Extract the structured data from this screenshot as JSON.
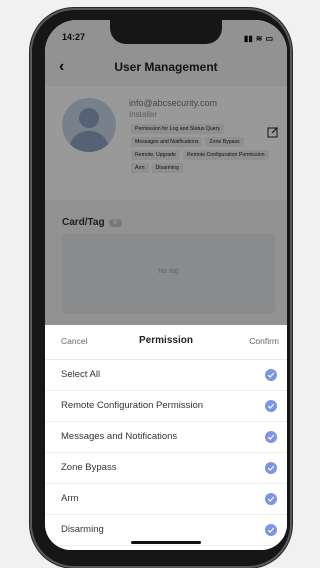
{
  "status_bar": {
    "time": "14:27"
  },
  "nav": {
    "title": "User Management"
  },
  "user": {
    "email": "info@abcsecurity.com",
    "role": "Installer",
    "permissions": [
      "Permission for Log and Status Query",
      "Messages and Notifications",
      "Zone Bypass",
      "Remote. Upgrade",
      "Remote Configuration Permission",
      "Arm",
      "Disarming"
    ]
  },
  "card_section": {
    "title": "Card/Tag",
    "count": "0",
    "empty_text": "No tag"
  },
  "sheet": {
    "cancel_label": "Cancel",
    "title": "Permission",
    "confirm_label": "Confirm",
    "options": [
      {
        "label": "Select All",
        "checked": true
      },
      {
        "label": "Remote Configuration Permission",
        "checked": true
      },
      {
        "label": "Messages and Notifications",
        "checked": true
      },
      {
        "label": "Zone Bypass",
        "checked": true
      },
      {
        "label": "Arm",
        "checked": true
      },
      {
        "label": "Disarming",
        "checked": true
      }
    ]
  },
  "colors": {
    "accent": "#7b93e8",
    "overlay": "rgba(0,0,0,0.4)"
  }
}
